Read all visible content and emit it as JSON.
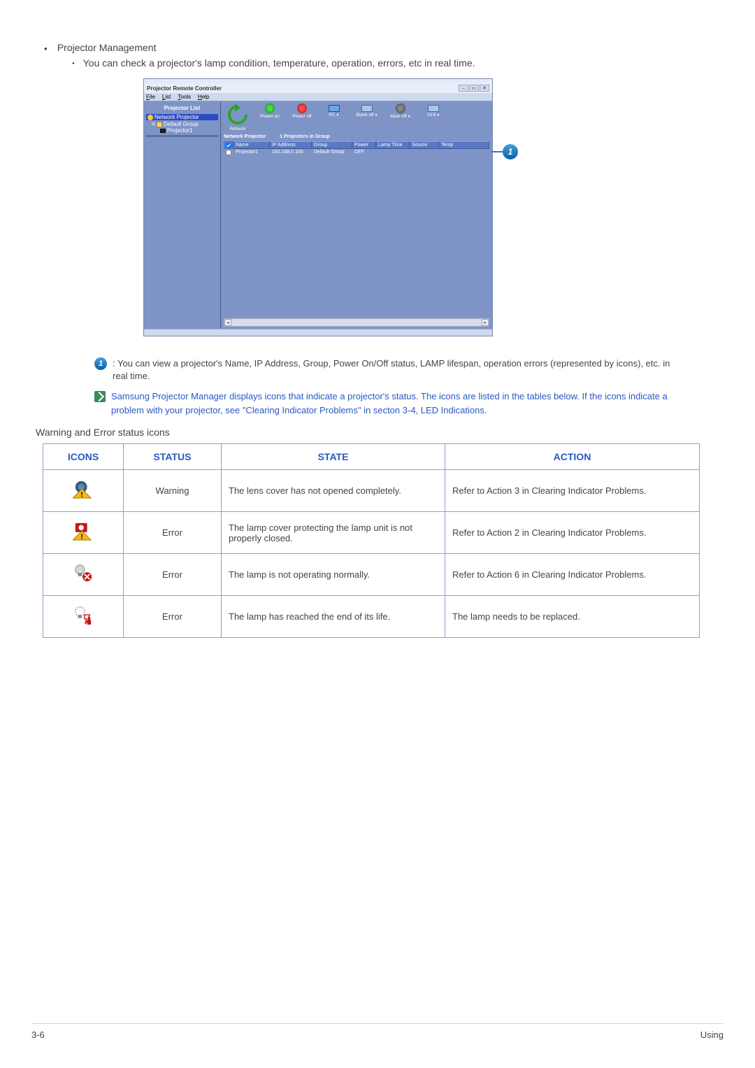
{
  "header": {
    "section_title": "Projector Management",
    "sub_bullet": "You can check a projector's lamp condition, temperature, operation, errors, etc in real time."
  },
  "app_window": {
    "title": "Projector Remote Controller",
    "menus": {
      "file": "File",
      "list": "List",
      "tools": "Tools",
      "help": "Help"
    },
    "win_controls": {
      "min": "–",
      "restore": "▭",
      "close": "✕"
    },
    "sidebar": {
      "title": "Projector List",
      "root": "Network Projector",
      "group": "Default Group",
      "item": "Projector1"
    },
    "toolbar": {
      "refresh": "Refresh",
      "power_on": "Power on",
      "power_off": "Power off",
      "pc": "PC",
      "blank_off": "Blank off",
      "mute_off": "Mute off",
      "aspect": "16:9"
    },
    "info_bar": {
      "left": "Network Projector",
      "right": "1 Projectors in Group"
    },
    "table": {
      "headers": {
        "name": "Name",
        "ip": "IP Address",
        "group": "Group",
        "power": "Power",
        "lamp": "Lamp Time",
        "source": "Source",
        "temp": "Temp"
      },
      "row": {
        "name": "Projector1",
        "ip": "192.168.0.100",
        "group": "Default Group",
        "power": "OFF"
      }
    }
  },
  "callouts": {
    "num1": "1",
    "num1_text_prefix": ": ",
    "num1_text": "You can view a projector's Name, IP Address, Group, Power On/Off status, LAMP lifespan, operation errors (represented by icons), etc. in real time.",
    "note_text": "Samsung Projector Manager displays icons that indicate a projector's status. The icons are listed in the tables below. If the icons indicate a problem with your projector, see \"Clearing Indicator Problems\" in secton 3-4, LED Indications."
  },
  "icons_section": {
    "heading": "Warning and Error status icons",
    "headers": {
      "icons": "ICONS",
      "status": "STATUS",
      "state": "STATE",
      "action": "ACTION"
    },
    "rows": [
      {
        "status": "Warning",
        "state": "The lens cover has not opened completely.",
        "action": "Refer to Action 3 in Clearing Indicator Problems."
      },
      {
        "status": "Error",
        "state": "The lamp cover protecting the lamp unit is not properly closed.",
        "action": "Refer to Action 2 in Clearing Indicator Problems."
      },
      {
        "status": "Error",
        "state": "The lamp is not operating normally.",
        "action": "Refer to Action 6 in Clearing Indicator Problems."
      },
      {
        "status": "Error",
        "state": "The lamp has reached the end of its life.",
        "action": "The lamp needs to be replaced."
      }
    ]
  },
  "footer": {
    "left": "3-6",
    "right": "Using"
  },
  "chart_data": {
    "type": "table",
    "title": "Warning and Error status icons",
    "columns": [
      "ICONS",
      "STATUS",
      "STATE",
      "ACTION"
    ],
    "rows": [
      [
        "lens-cover-warning-icon",
        "Warning",
        "The lens cover has not opened completely.",
        "Refer to Action 3 in Clearing Indicator Problems."
      ],
      [
        "lamp-cover-error-icon",
        "Error",
        "The lamp cover protecting the lamp unit is not properly closed.",
        "Refer to Action 2 in Clearing Indicator Problems."
      ],
      [
        "lamp-error-icon",
        "Error",
        "The lamp is not operating normally.",
        "Refer to Action 6 in Clearing Indicator Problems."
      ],
      [
        "lamp-life-error-icon",
        "Error",
        "The lamp has reached the end of its life.",
        "The lamp needs to be replaced."
      ]
    ]
  }
}
